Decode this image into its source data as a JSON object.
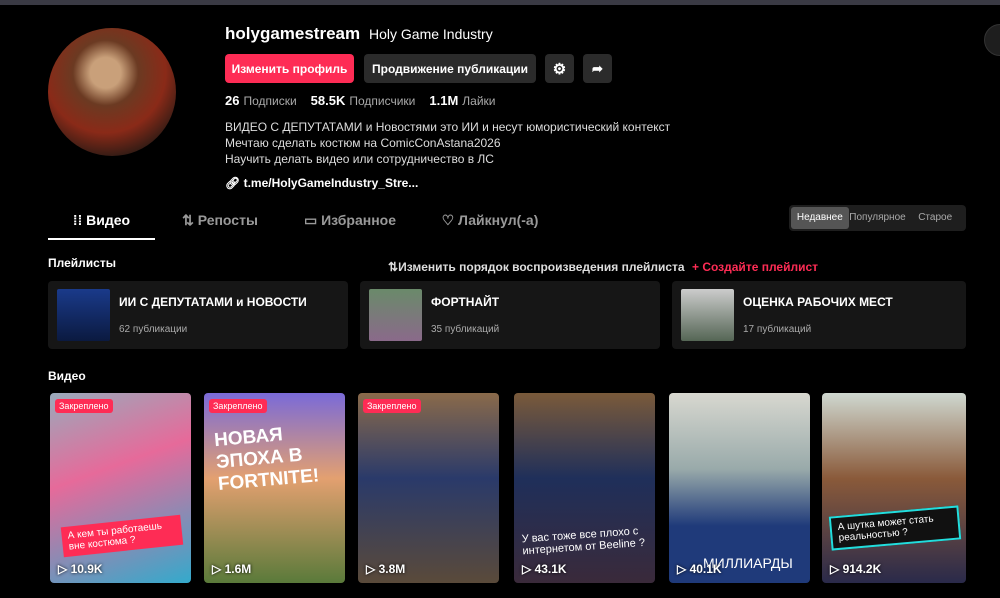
{
  "profile": {
    "username": "holygamestream",
    "display_name": "Holy Game Industry",
    "edit_button": "Изменить профиль",
    "promote_button": "Продвижение публикации",
    "stats": [
      {
        "value": "26",
        "label": "Подписки"
      },
      {
        "value": "58.5K",
        "label": "Подписчики"
      },
      {
        "value": "1.1M",
        "label": "Лайки"
      }
    ],
    "bio": [
      "ВИДЕО С ДЕПУТАТАМИ и Новостями это ИИ и несут юмористический контекст",
      "Мечтаю сделать костюм на ComicConAstana2026",
      "Научить делать видео или сотрудничество в ЛС"
    ],
    "link": "t.me/HolyGameIndustry_Stre..."
  },
  "tabs": [
    "Видео",
    "Репосты",
    "Избранное",
    "Лайкнул(-а)"
  ],
  "sort": [
    "Недавнее",
    "Популярное",
    "Старое"
  ],
  "playlists": {
    "title": "Плейлисты",
    "reorder": "Изменить порядок воспроизведения плейлиста",
    "create": "+ Создайте плейлист",
    "items": [
      {
        "title": "ИИ С ДЕПУТАТАМИ и НОВОСТИ",
        "count": "62 публикации"
      },
      {
        "title": "ФОРТНАЙТ",
        "count": "35 публикаций"
      },
      {
        "title": "ОЦЕНКА РАБОЧИХ МЕСТ",
        "count": "17 публикаций"
      }
    ]
  },
  "videos": {
    "title": "Видео",
    "pinned_label": "Закреплено",
    "items": [
      {
        "views": "10.9K",
        "caption": "А кем ты работаешь вне костюма ?"
      },
      {
        "views": "1.6M",
        "caption": "НОВАЯ ЭПОХА В FORTNITE!"
      },
      {
        "views": "3.8M"
      },
      {
        "views": "43.1K",
        "caption": "У вас тоже все плохо с интернетом от Beeline ?"
      },
      {
        "views": "40.1K",
        "caption": "МИЛЛИАРДЫ"
      },
      {
        "views": "914.2K",
        "caption": "А шутка может стать реальностью ?"
      }
    ]
  }
}
